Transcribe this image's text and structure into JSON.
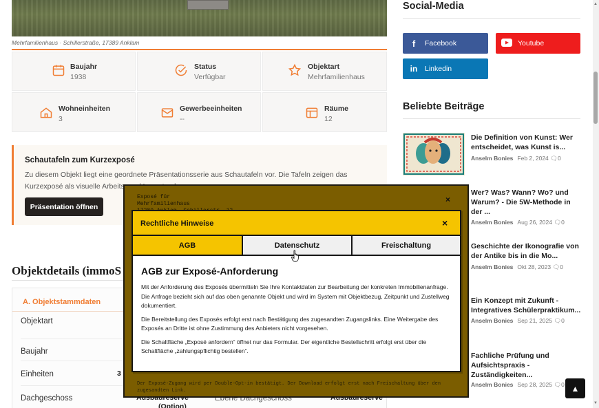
{
  "photo_caption": "Mehrfamilienhaus · Schillerstraße, 17389 Anklam",
  "facts": [
    {
      "label": "Baujahr",
      "value": "1938",
      "icon": "calendar-icon"
    },
    {
      "label": "Status",
      "value": "Verfügbar",
      "icon": "check-circle-icon"
    },
    {
      "label": "Objektart",
      "value": "Mehrfamilienhaus",
      "icon": "star-icon"
    },
    {
      "label": "Wohneinheiten",
      "value": "3",
      "icon": "home-icon"
    },
    {
      "label": "Gewerbeeinheiten",
      "value": "--",
      "icon": "mail-icon"
    },
    {
      "label": "Räume",
      "value": "12",
      "icon": "layout-icon"
    }
  ],
  "notice": {
    "title": "Schautafeln zum Kurzexposé",
    "text": "Zu diesem Objekt liegt eine geordnete Präsentationsserie aus Schautafeln vor. Die Tafeln zeigen das Kurzexposé als visuelle Arbeits- und Lesestrecke.",
    "button": "Präsentation öffnen"
  },
  "details": {
    "section_title": "Objektdetails (immoS",
    "group_title": "A. Objektstammdaten",
    "rows": [
      {
        "key": "Objektart",
        "value": ""
      },
      {
        "key": "Baujahr",
        "value": ""
      },
      {
        "key": "Einheiten",
        "value": "3 ("
      },
      {
        "key": "Dachgeschoss",
        "value": "Ausbaureserve",
        "value2": "(Option)",
        "extra_key": "Ebene Dachgeschoss",
        "extra_value": "Ausbaureserve"
      }
    ]
  },
  "sidebar": {
    "social_title": "Social-Media",
    "social": [
      {
        "label": "Facebook",
        "icon": "facebook-icon",
        "color": "#3b5998"
      },
      {
        "label": "Youtube",
        "icon": "youtube-icon",
        "color": "#ee1d1d"
      },
      {
        "label": "Linkedin",
        "icon": "linkedin-icon",
        "color": "#0a77b5"
      }
    ],
    "popular_title": "Beliebte Beiträge",
    "posts": [
      {
        "title": "Die Definition von Kunst: Wer entscheidet, was Kunst is...",
        "author": "Anselm Bonies",
        "date": "Feb 2, 2024",
        "comments": "0"
      },
      {
        "title": "Wer? Was? Wann? Wo? und Warum? - Die 5W-Methode in der ...",
        "author": "Anselm Bonies",
        "date": "Aug 26, 2024",
        "comments": "0"
      },
      {
        "title": "Geschichte der Ikonografie von der Antike bis in die Mo...",
        "author": "Anselm Bonies",
        "date": "Okt 28, 2023",
        "comments": "0"
      },
      {
        "title": "Ein Konzept mit Zukunft - Integratives Schülerpraktikum...",
        "author": "Anselm Bonies",
        "date": "Sep 21, 2025",
        "comments": "0"
      },
      {
        "title": "Fachliche Prüfung und Aufsichtspraxis - Zuständigkeiten...",
        "author": "Anselm Bonies",
        "date": "Sep 28, 2025",
        "comments": "0"
      }
    ]
  },
  "outer_modal": {
    "text": "Exposé für\nMehrfamilienhaus\n17389 Anklam, Schillerstr. 13",
    "footer": "Der Exposé-Zugang wird per Double-Opt-in bestätigt. Der Download erfolgt erst nach Freischaltung über den\nzugesandten Link.",
    "close": "×"
  },
  "legal_modal": {
    "title": "Rechtliche Hinweise",
    "close": "×",
    "tabs": [
      "AGB",
      "Datenschutz",
      "Freischaltung"
    ],
    "active_tab": "AGB",
    "active_color": "#f5c400",
    "body_title": "AGB zur Exposé-Anforderung",
    "paragraphs": [
      "Mit der Anforderung des Exposés übermitteln Sie Ihre Kontaktdaten zur Bearbeitung der konkreten Immobilienanfrage. Die Anfrage bezieht sich auf das oben genannte Objekt und wird im System mit Objektbezug, Zeitpunkt und Zustellweg dokumentiert.",
      "Die Bereitstellung des Exposés erfolgt erst nach Bestätigung des zugesandten Zugangslinks. Eine Weitergabe des Exposés an Dritte ist ohne Zustimmung des Anbieters nicht vorgesehen.",
      "Die Schaltfläche „Exposé anfordern“ öffnet nur das Formular. Der eigentliche Bestellschritt erfolgt erst über die Schaltfläche „zahlungspflichtig bestellen“."
    ]
  },
  "accent_color": "#f07d33"
}
